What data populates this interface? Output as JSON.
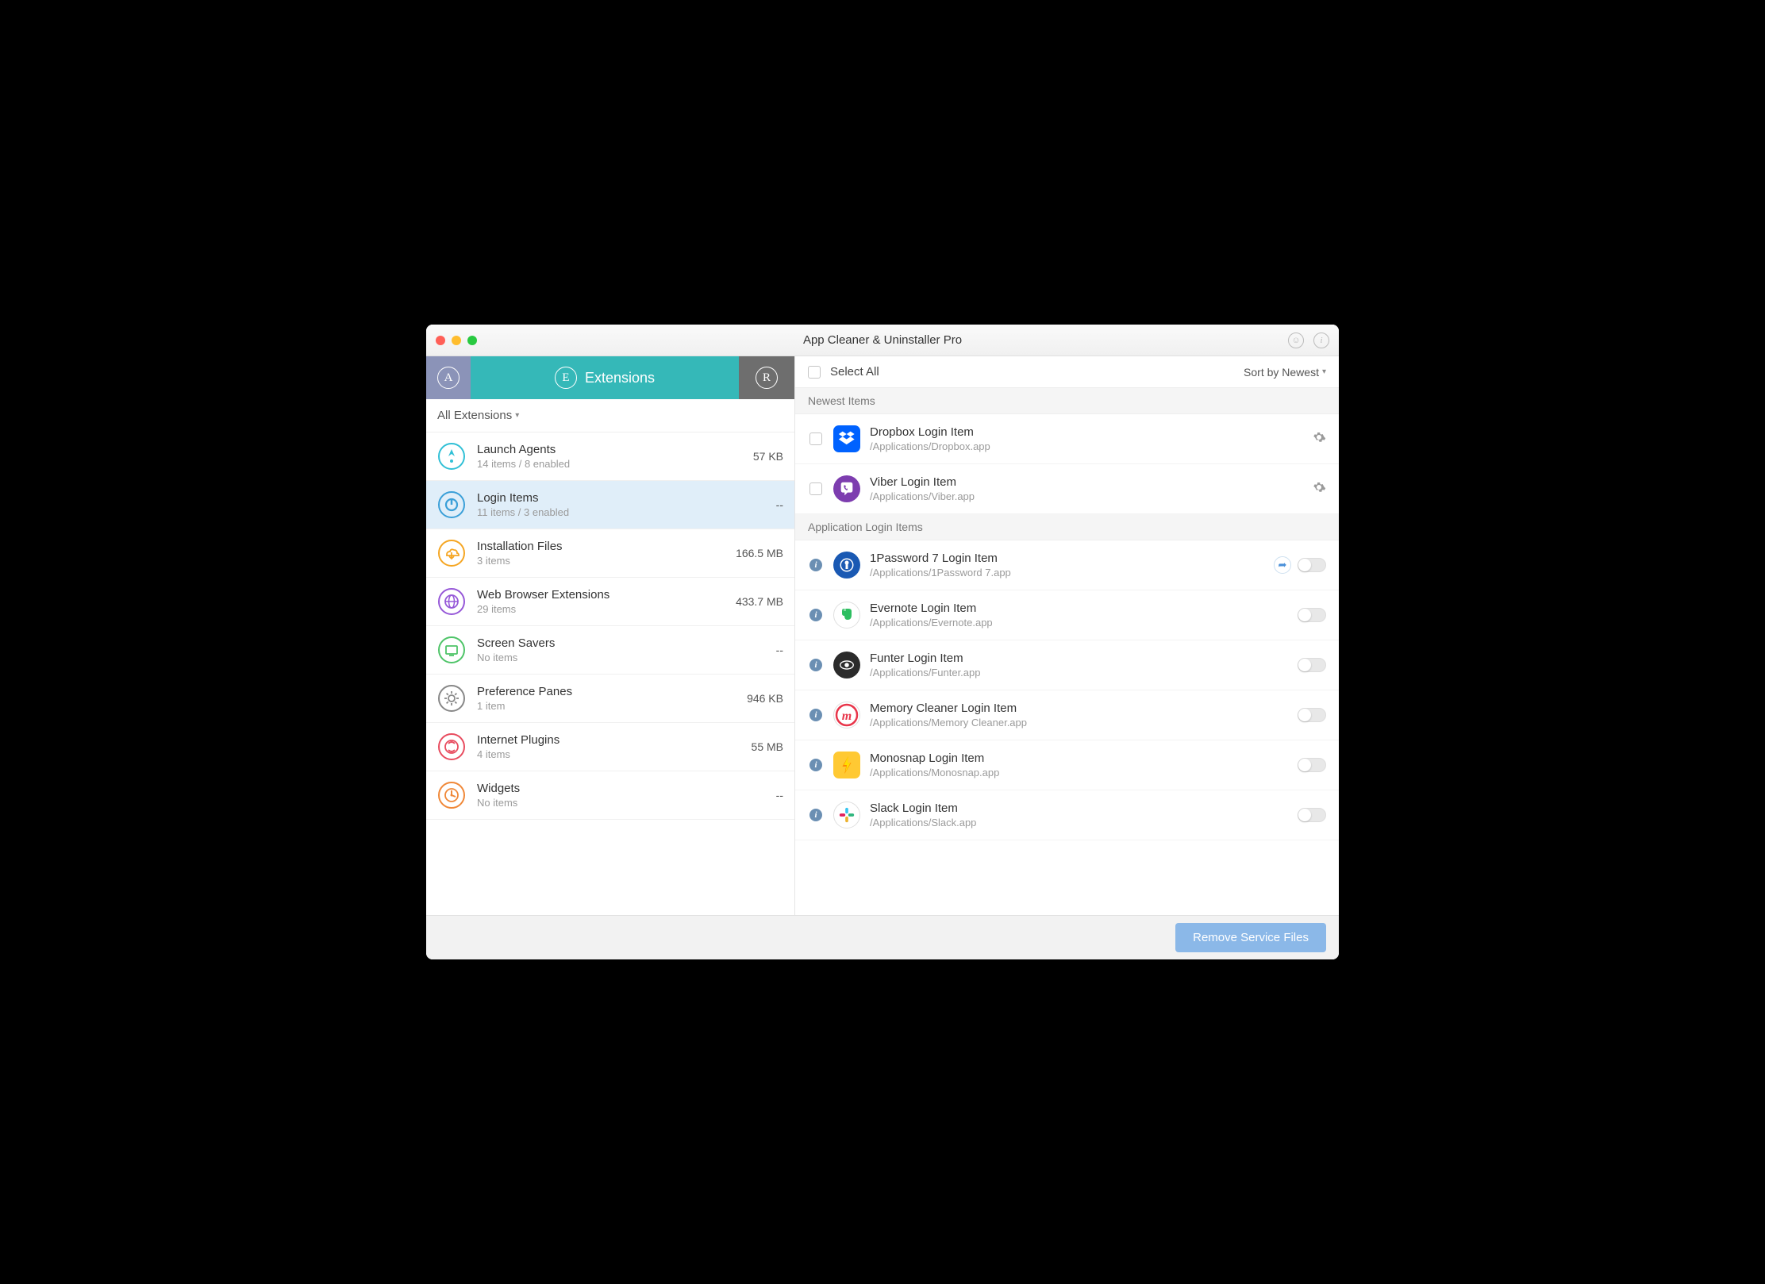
{
  "window": {
    "title": "App Cleaner & Uninstaller Pro"
  },
  "tabs": {
    "extensions_label": "Extensions"
  },
  "filter": {
    "label": "All Extensions"
  },
  "categories": [
    {
      "title": "Launch Agents",
      "sub": "14 items / 8 enabled",
      "size": "57 KB",
      "color": "#31c0d6",
      "selected": false,
      "icon": "rocket"
    },
    {
      "title": "Login Items",
      "sub": "11 items / 3 enabled",
      "size": "--",
      "color": "#3a9fd8",
      "selected": true,
      "icon": "power"
    },
    {
      "title": "Installation Files",
      "sub": "3 items",
      "size": "166.5 MB",
      "color": "#f5a623",
      "selected": false,
      "icon": "cloud"
    },
    {
      "title": "Web Browser Extensions",
      "sub": "29 items",
      "size": "433.7 MB",
      "color": "#9658d8",
      "selected": false,
      "icon": "globe"
    },
    {
      "title": "Screen Savers",
      "sub": "No items",
      "size": "--",
      "color": "#4ec468",
      "selected": false,
      "icon": "screen"
    },
    {
      "title": "Preference Panes",
      "sub": "1 item",
      "size": "946 KB",
      "color": "#888888",
      "selected": false,
      "icon": "gear"
    },
    {
      "title": "Internet Plugins",
      "sub": "4 items",
      "size": "55 MB",
      "color": "#e84c5f",
      "selected": false,
      "icon": "plugin"
    },
    {
      "title": "Widgets",
      "sub": "No items",
      "size": "--",
      "color": "#f08838",
      "selected": false,
      "icon": "widget"
    }
  ],
  "topbar": {
    "select_all": "Select All",
    "sort": "Sort by Newest"
  },
  "sections": [
    {
      "header": "Newest Items",
      "type": "checkbox",
      "items": [
        {
          "title": "Dropbox Login Item",
          "path": "/Applications/Dropbox.app",
          "icon_bg": "#0062ff",
          "icon_glyph": "dropbox"
        },
        {
          "title": "Viber Login Item",
          "path": "/Applications/Viber.app",
          "icon_bg": "#7d3daf",
          "icon_glyph": "viber"
        }
      ]
    },
    {
      "header": "Application Login Items",
      "type": "toggle",
      "items": [
        {
          "title": "1Password 7 Login Item",
          "path": "/Applications/1Password 7.app",
          "icon_bg": "#1a59b3",
          "icon_glyph": "1p",
          "share": true
        },
        {
          "title": "Evernote Login Item",
          "path": "/Applications/Evernote.app",
          "icon_bg": "#ffffff",
          "icon_glyph": "evernote"
        },
        {
          "title": "Funter Login Item",
          "path": "/Applications/Funter.app",
          "icon_bg": "#2b2b2b",
          "icon_glyph": "eye"
        },
        {
          "title": "Memory Cleaner Login Item",
          "path": "/Applications/Memory Cleaner.app",
          "icon_bg": "#ffffff",
          "icon_glyph": "m"
        },
        {
          "title": "Monosnap Login Item",
          "path": "/Applications/Monosnap.app",
          "icon_bg": "#ffc933",
          "icon_glyph": "bolt"
        },
        {
          "title": "Slack Login Item",
          "path": "/Applications/Slack.app",
          "icon_bg": "#ffffff",
          "icon_glyph": "slack"
        }
      ]
    }
  ],
  "footer": {
    "remove_button": "Remove Service Files"
  }
}
